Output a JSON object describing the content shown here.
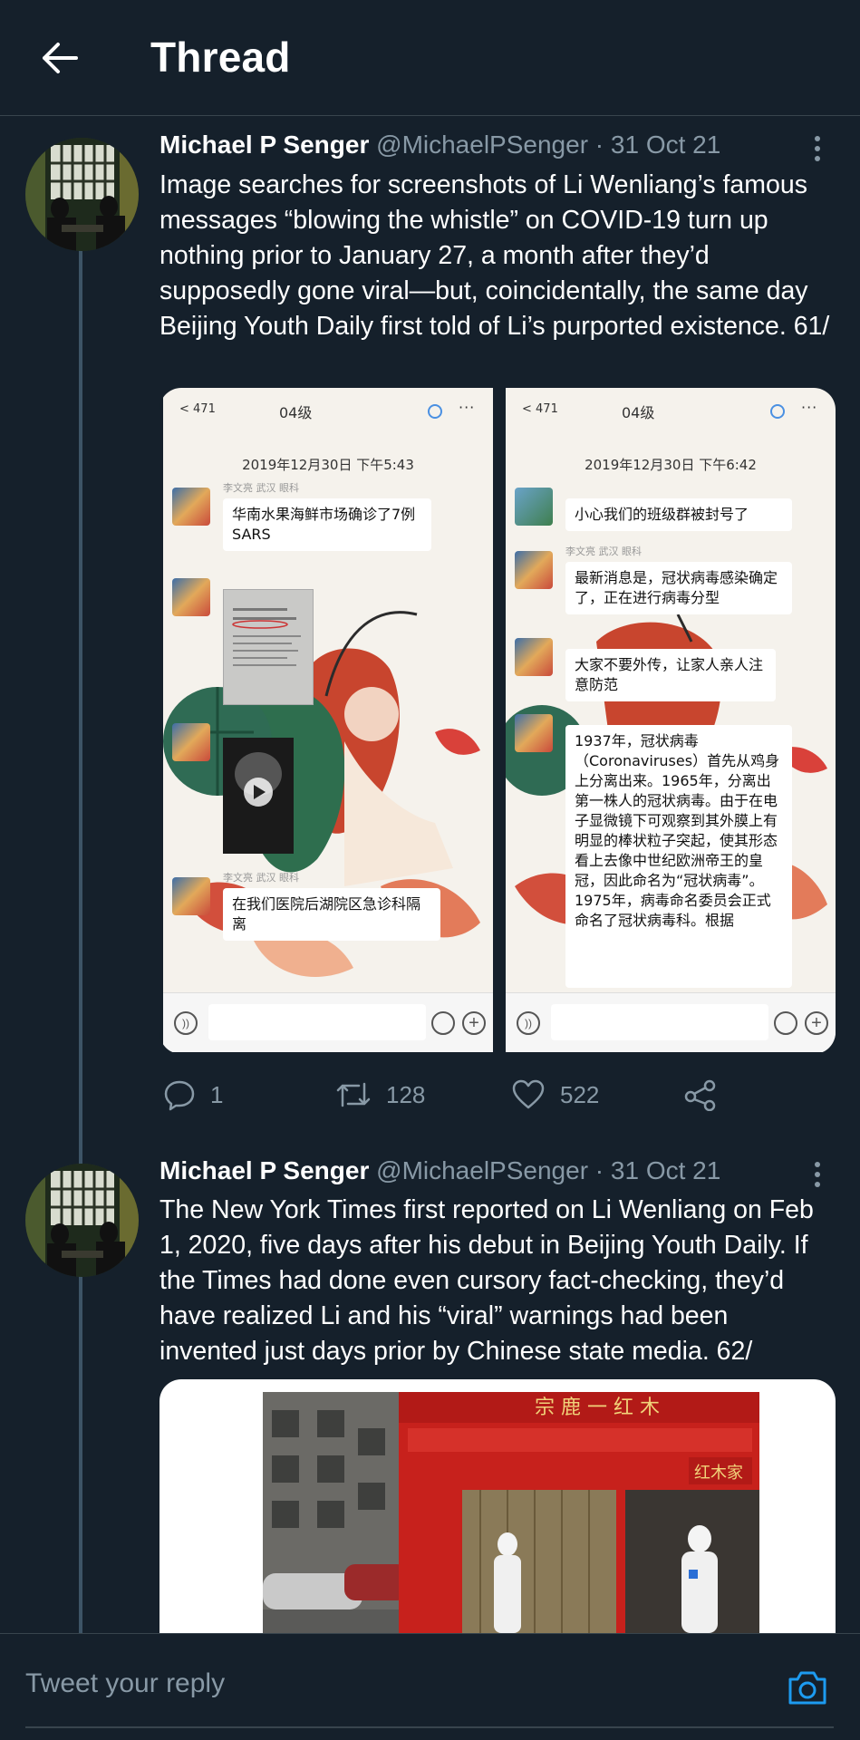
{
  "header": {
    "title": "Thread"
  },
  "tweets": [
    {
      "name": "Michael P Senger",
      "handle": "@MichaelPSenger",
      "date": "· 31 Oct 21",
      "text": "Image searches for screenshots of Li Wenliang’s famous messages “blowing the whistle” on COVID-19 turn up nothing prior to January 27, a month after they’d supposedly gone viral—but, coincidentally, the same day Beijing Youth Daily first told of Li’s purported existence. 61/",
      "media": {
        "left_phone": {
          "back": "< 471",
          "title": "04级",
          "date": "2019年12月30日 下午5:43",
          "messages": [
            {
              "sender": "李文亮 武汉 眼科",
              "text": "华南水果海鲜市场确诊了7例SARS"
            },
            {
              "sender": "李文亮 武汉 眼科",
              "text": "在我们医院后湖院区急诊科隔离"
            }
          ]
        },
        "right_phone": {
          "back": "< 471",
          "title": "04级",
          "date": "2019年12月30日 下午6:42",
          "messages": [
            {
              "sender": "",
              "text": "小心我们的班级群被封号了"
            },
            {
              "sender": "李文亮 武汉 眼科",
              "text": "最新消息是，冠状病毒感染确定了，正在进行病毒分型"
            },
            {
              "sender": "",
              "text": "大家不要外传，让家人亲人注意防范"
            },
            {
              "sender": "",
              "text": "1937年，冠状病毒（Coronaviruses）首先从鸡身上分离出来。1965年，分离出第一株人的冠状病毒。由于在电子显微镜下可观察到其外膜上有明显的棒状粒子突起，使其形态看上去像中世纪欧洲帝王的皇冠，因此命名为“冠状病毒”。1975年，病毒命名委员会正式命名了冠状病毒科。根据"
            }
          ]
        }
      },
      "actions": {
        "replies": "1",
        "retweets": "128",
        "likes": "522"
      }
    },
    {
      "name": "Michael P Senger",
      "handle": "@MichaelPSenger",
      "date": "· 31 Oct 21",
      "text": "The New York Times first reported on Li Wenliang on Feb 1, 2020, five days after his debut in Beijing Youth Daily. If the Times had done even cursory fact-checking, they’d have realized Li and his “viral” warnings had been invented just days prior by Chinese state media. 62/",
      "media": {
        "sign_text": "红木家"
      }
    }
  ],
  "reply": {
    "placeholder": "Tweet your reply"
  },
  "colors": {
    "background": "#15202b",
    "muted": "#8899a6",
    "accent": "#1d9bf0",
    "divider": "#38444d"
  },
  "icons": [
    "back-arrow-icon",
    "more-icon",
    "reply-icon",
    "retweet-icon",
    "like-icon",
    "share-icon",
    "camera-icon"
  ]
}
